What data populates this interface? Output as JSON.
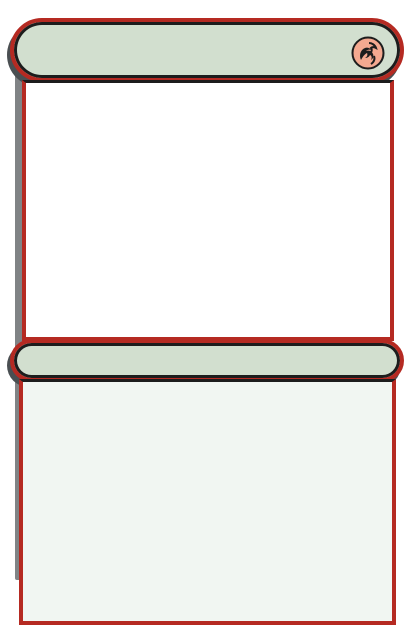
{
  "card": {
    "title": "",
    "type_line": "",
    "rules_text": "",
    "mana_symbol_icon": "red-mana-dragon-icon"
  },
  "colors": {
    "frame": "#b52a22",
    "bar": "#d2dfcf",
    "text_box": "#f1f6f2",
    "outline": "#1d1d1d",
    "mana_symbol": "#f4a990"
  }
}
